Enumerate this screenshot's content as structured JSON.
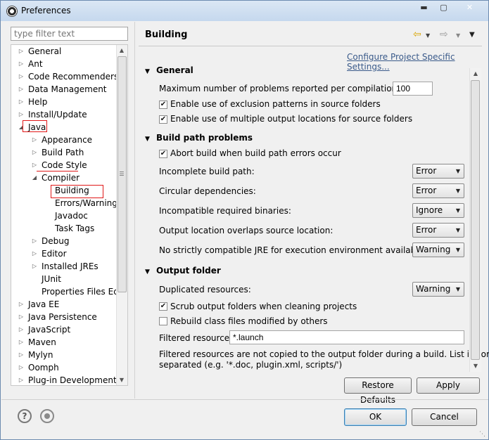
{
  "window": {
    "title": "Preferences"
  },
  "filter": {
    "placeholder": "type filter text"
  },
  "tree": {
    "items": [
      {
        "label": "General",
        "twisty": "▷",
        "indent": 0
      },
      {
        "label": "Ant",
        "twisty": "▷",
        "indent": 0
      },
      {
        "label": "Code Recommenders",
        "twisty": "▷",
        "indent": 0
      },
      {
        "label": "Data Management",
        "twisty": "▷",
        "indent": 0
      },
      {
        "label": "Help",
        "twisty": "▷",
        "indent": 0
      },
      {
        "label": "Install/Update",
        "twisty": "▷",
        "indent": 0
      },
      {
        "label": "Java",
        "twisty": "◢",
        "indent": 0
      },
      {
        "label": "Appearance",
        "twisty": "▷",
        "indent": 1
      },
      {
        "label": "Build Path",
        "twisty": "▷",
        "indent": 1
      },
      {
        "label": "Code Style",
        "twisty": "▷",
        "indent": 1
      },
      {
        "label": "Compiler",
        "twisty": "◢",
        "indent": 1
      },
      {
        "label": "Building",
        "twisty": "",
        "indent": 2
      },
      {
        "label": "Errors/Warnings",
        "twisty": "",
        "indent": 2
      },
      {
        "label": "Javadoc",
        "twisty": "",
        "indent": 2
      },
      {
        "label": "Task Tags",
        "twisty": "",
        "indent": 2
      },
      {
        "label": "Debug",
        "twisty": "▷",
        "indent": 1
      },
      {
        "label": "Editor",
        "twisty": "▷",
        "indent": 1
      },
      {
        "label": "Installed JREs",
        "twisty": "▷",
        "indent": 1
      },
      {
        "label": "JUnit",
        "twisty": "",
        "indent": 1
      },
      {
        "label": "Properties Files Edito",
        "twisty": "",
        "indent": 1
      },
      {
        "label": "Java EE",
        "twisty": "▷",
        "indent": 0
      },
      {
        "label": "Java Persistence",
        "twisty": "▷",
        "indent": 0
      },
      {
        "label": "JavaScript",
        "twisty": "▷",
        "indent": 0
      },
      {
        "label": "Maven",
        "twisty": "▷",
        "indent": 0
      },
      {
        "label": "Mylyn",
        "twisty": "▷",
        "indent": 0
      },
      {
        "label": "Oomph",
        "twisty": "▷",
        "indent": 0
      },
      {
        "label": "Plug-in Development",
        "twisty": "▷",
        "indent": 0
      }
    ],
    "selected": "Building"
  },
  "page": {
    "title": "Building",
    "configure_link": "Configure Project Specific Settings...",
    "general": {
      "heading": "General",
      "max_problems_label": "Maximum number of problems reported per compilation unit:",
      "max_problems_value": "100",
      "exclusion_label": "Enable use of exclusion patterns in source folders",
      "exclusion_checked": true,
      "multiple_output_label": "Enable use of multiple output locations for source folders",
      "multiple_output_checked": true
    },
    "build_path": {
      "heading": "Build path problems",
      "abort_label": "Abort build when build path errors occur",
      "abort_checked": true,
      "settings": [
        {
          "label": "Incomplete build path:",
          "value": "Error"
        },
        {
          "label": "Circular dependencies:",
          "value": "Error"
        },
        {
          "label": "Incompatible required binaries:",
          "value": "Ignore"
        },
        {
          "label": "Output location overlaps source location:",
          "value": "Error"
        },
        {
          "label": "No strictly compatible JRE for execution environment available:",
          "value": "Warning"
        }
      ]
    },
    "output_folder": {
      "heading": "Output folder",
      "duplicated_label": "Duplicated resources:",
      "duplicated_value": "Warning",
      "scrub_label": "Scrub output folders when cleaning projects",
      "scrub_checked": true,
      "rebuild_label": "Rebuild class files modified by others",
      "rebuild_checked": false,
      "filtered_label": "Filtered resources:",
      "filtered_value": "*.launch",
      "note_line1": "Filtered resources are not copied to the output folder during a build. List is comma",
      "note_line2": "separated (e.g. '*.doc, plugin.xml, scripts/')"
    },
    "restore_defaults_label": "Restore Defaults",
    "apply_label": "Apply"
  },
  "footer": {
    "help_glyph": "?",
    "ok_label": "OK",
    "cancel_label": "Cancel"
  },
  "colors": {
    "annotation": "#e01818",
    "link": "#3a5a8a"
  }
}
